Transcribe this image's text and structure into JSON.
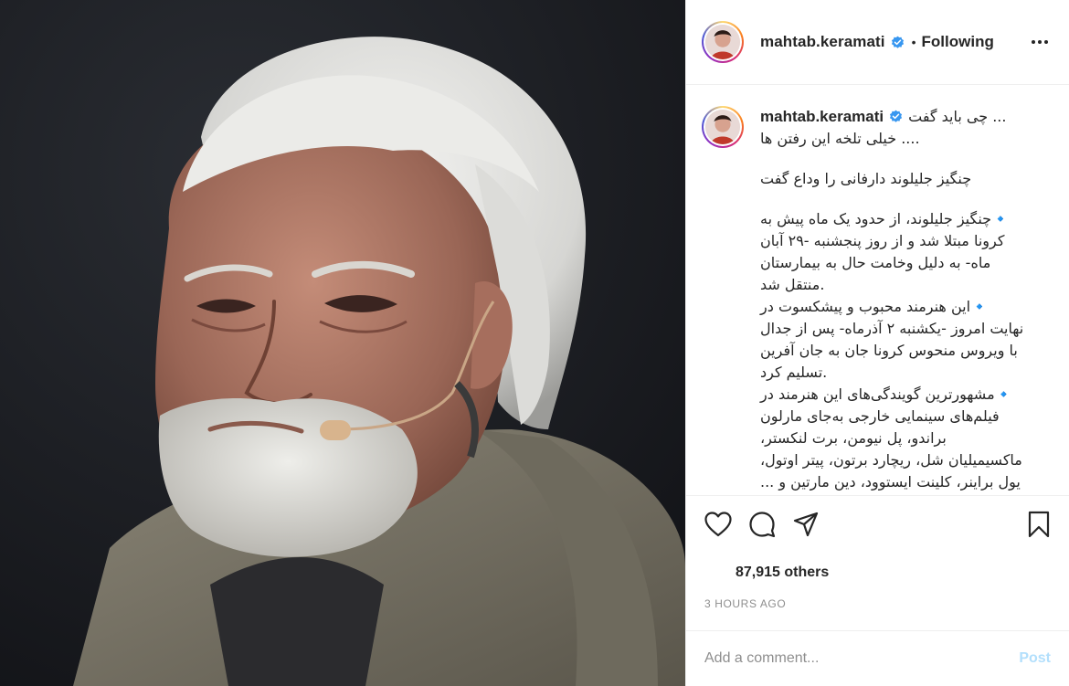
{
  "photo": {
    "subject": "portrait-photo",
    "alt": ""
  },
  "header": {
    "username": "mahtab.keramati",
    "separator": "•",
    "follow_state": "Following",
    "more_icon": "more-horizontal-icon"
  },
  "caption": {
    "username": "mahtab.keramati",
    "first_line": "چی باید گفت ...",
    "lines_block_1": [
      ".... خیلی تلخه این رفتن ها"
    ],
    "lines_block_2": [
      "چنگیز جلیلوند دارفانی را وداع گفت"
    ],
    "lines_block_3": [
      "🔹چنگیز جلیلوند، از حدود یک ماه پیش به",
      "کرونا مبتلا شد و از روز پنجشنبه -۲۹ آبان",
      "ماه- به دلیل وخامت حال به بیمارستان",
      ".منتقل شد",
      "🔹این هنرمند محبوب و پیشکسوت در",
      "نهایت امروز -یکشنبه ۲ آذرماه- پس از جدال",
      "با ویروس منحوس کرونا جان به جان آفرین",
      ".تسلیم کرد",
      "🔹مشهورترین گویندگی‌های این هنرمند در",
      "فیلم‌های سینمایی خارجی به‌جای مارلون",
      "براندو، پل نیومن، برت لنکستر،",
      "ماکسیمیلیان شل، ریچارد برتون، پیتر اوتول،",
      "یول براینر، کلینت ایستوود، دین مارتین و ..."
    ]
  },
  "actions": {
    "like_icon": "heart-icon",
    "comment_icon": "comment-icon",
    "share_icon": "paper-plane-icon",
    "save_icon": "bookmark-icon"
  },
  "likes": {
    "text": "87,915 others"
  },
  "timestamp": "3 HOURS AGO",
  "composer": {
    "placeholder": "Add a comment...",
    "post_label": "Post"
  },
  "colors": {
    "verified": "#3897f0",
    "post_disabled": "#b2dffc",
    "muted": "#8e8e8e",
    "border": "#efefef",
    "diamond": "#1d9bf0"
  }
}
